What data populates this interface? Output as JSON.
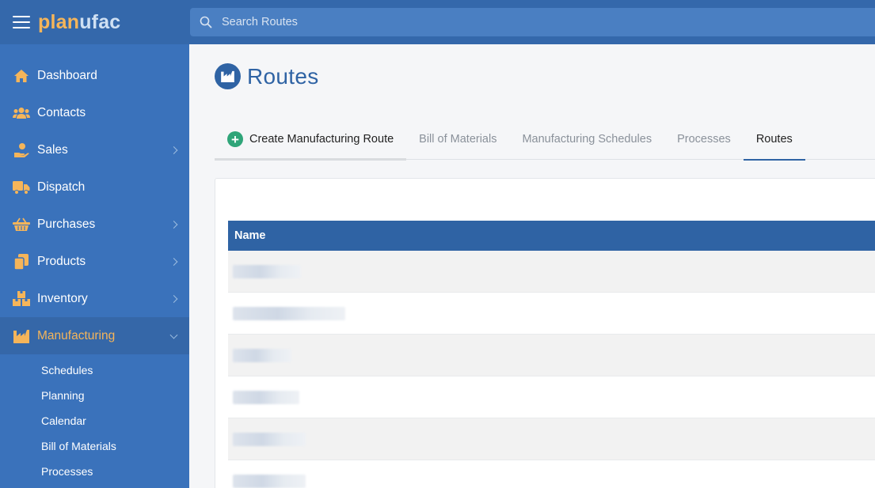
{
  "brand": {
    "part1": "plan",
    "part2": "ufac",
    "accent": "#f5b55a"
  },
  "search": {
    "placeholder": "Search Routes",
    "icon": "search-icon"
  },
  "sidebar": {
    "items": [
      {
        "label": "Dashboard",
        "icon": "home-icon",
        "has_children": false
      },
      {
        "label": "Contacts",
        "icon": "users-icon",
        "has_children": false
      },
      {
        "label": "Sales",
        "icon": "hand-coin-icon",
        "has_children": true
      },
      {
        "label": "Dispatch",
        "icon": "truck-icon",
        "has_children": false
      },
      {
        "label": "Purchases",
        "icon": "basket-icon",
        "has_children": true
      },
      {
        "label": "Products",
        "icon": "copy-icon",
        "has_children": true
      },
      {
        "label": "Inventory",
        "icon": "boxes-icon",
        "has_children": true
      },
      {
        "label": "Manufacturing",
        "icon": "factory-icon",
        "has_children": true,
        "active": true
      }
    ],
    "subitems": [
      "Schedules",
      "Planning",
      "Calendar",
      "Bill of Materials",
      "Processes"
    ]
  },
  "page": {
    "title": "Routes",
    "icon": "factory-icon"
  },
  "tabs": [
    {
      "label": "Create Manufacturing Route",
      "icon": "plus-circle-icon"
    },
    {
      "label": "Bill of Materials"
    },
    {
      "label": "Manufacturing Schedules"
    },
    {
      "label": "Processes"
    },
    {
      "label": "Routes",
      "active": true
    }
  ],
  "table": {
    "columns": [
      "Name"
    ],
    "rows_redacted": 6
  },
  "colors": {
    "sidebar": "#3a72bb",
    "header": "#3468ab",
    "primary": "#2f63a4",
    "success": "#2fa579"
  }
}
